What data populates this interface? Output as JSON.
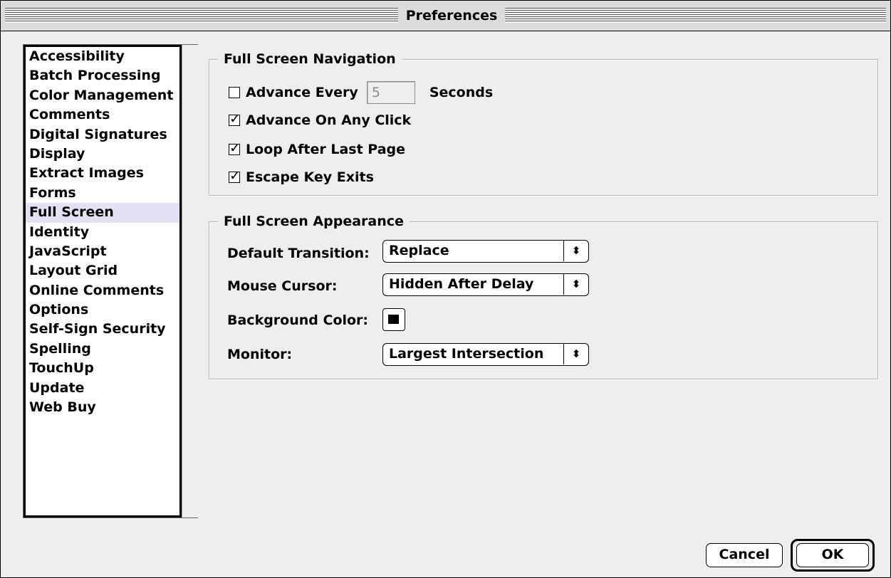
{
  "window": {
    "title": "Preferences"
  },
  "sidebar": {
    "selected_index": 8,
    "items": [
      "Accessibility",
      "Batch Processing",
      "Color Management",
      "Comments",
      "Digital Signatures",
      "Display",
      "Extract Images",
      "Forms",
      "Full Screen",
      "Identity",
      "JavaScript",
      "Layout Grid",
      "Online Comments",
      "Options",
      "Self-Sign Security",
      "Spelling",
      "TouchUp",
      "Update",
      "Web Buy"
    ]
  },
  "navigation": {
    "title": "Full Screen Navigation",
    "advance_every": {
      "label": "Advance Every",
      "checked": false,
      "value": "5",
      "unit": "Seconds"
    },
    "advance_on_click": {
      "label": "Advance On Any Click",
      "checked": true
    },
    "loop_after_last": {
      "label": "Loop After Last Page",
      "checked": true
    },
    "escape_exits": {
      "label": "Escape Key Exits",
      "checked": true
    }
  },
  "appearance": {
    "title": "Full Screen Appearance",
    "default_transition": {
      "label": "Default Transition:",
      "value": "Replace"
    },
    "mouse_cursor": {
      "label": "Mouse Cursor:",
      "value": "Hidden After Delay"
    },
    "background_color": {
      "label": "Background Color:",
      "color": "#000000"
    },
    "monitor": {
      "label": "Monitor:",
      "value": "Largest Intersection"
    }
  },
  "buttons": {
    "cancel": "Cancel",
    "ok": "OK"
  },
  "icons": {
    "checkmark": "☑",
    "popup_arrows": "⬍"
  }
}
